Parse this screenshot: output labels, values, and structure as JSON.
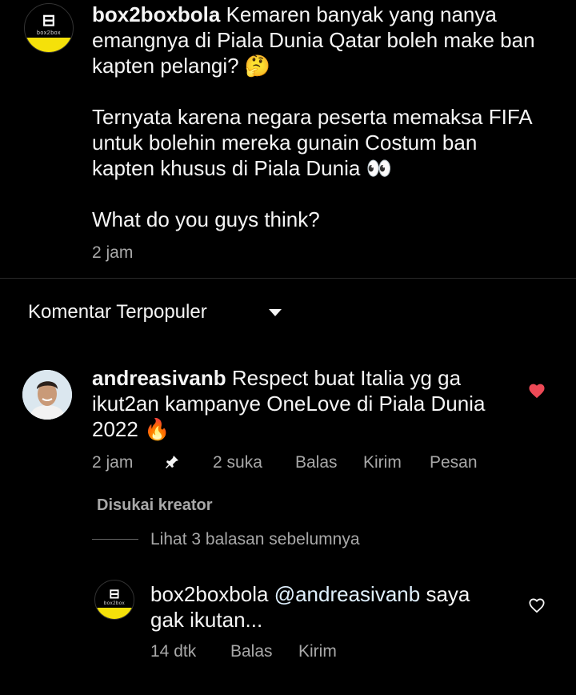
{
  "post": {
    "username": "box2boxbola",
    "paragraphs": [
      "Kemaren banyak yang nanya emangnya di Piala Dunia Qatar boleh make ban kapten pelangi? 🤔",
      "Ternyata karena negara peserta memaksa FIFA untuk bolehin mereka gunain Costum ban kapten khusus di Piala Dunia 👀",
      "What do you guys think?"
    ],
    "time": "2 jam",
    "avatar_text": "box2box"
  },
  "sort": {
    "label": "Komentar Terpopuler"
  },
  "comment": {
    "username": "andreasivanb",
    "text": "Respect buat Italia yg ga ikut2an kampanye OneLove di Piala Dunia 2022 🔥",
    "time": "2 jam",
    "likes": "2 suka",
    "reply_label": "Balas",
    "send_label": "Kirim",
    "message_label": "Pesan",
    "liked_by_creator": "Disukai kreator",
    "view_replies": "Lihat 3 balasan sebelumnya"
  },
  "reply": {
    "username": "box2boxbola",
    "mention": "@andreasivanb",
    "text": "saya gak ikutan...",
    "time": "14 dtk",
    "reply_label": "Balas",
    "send_label": "Kirim",
    "avatar_text": "box2box"
  },
  "colors": {
    "heart": "#ed4956",
    "bg": "#000000",
    "muted": "#a8a8a8"
  }
}
